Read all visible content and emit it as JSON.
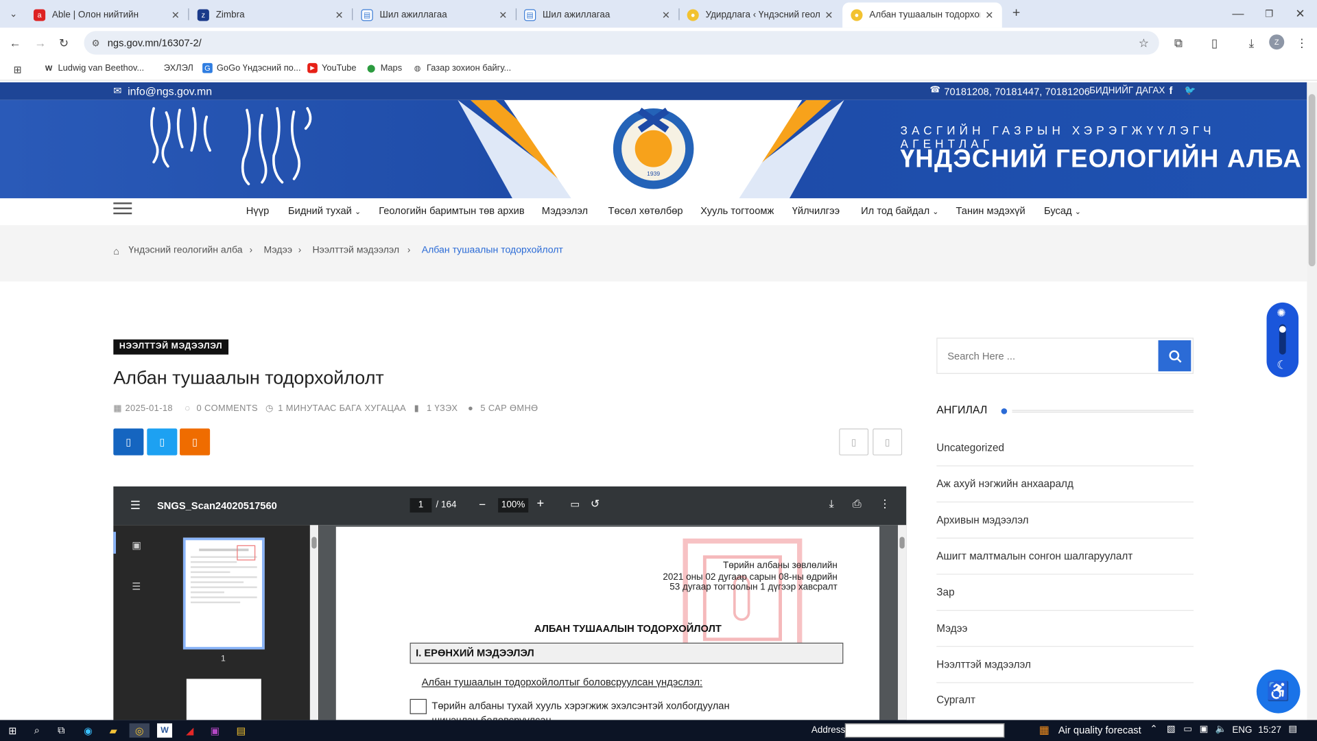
{
  "browser": {
    "tabs": [
      {
        "title": "Able | Олон нийтийн",
        "active": false
      },
      {
        "title": "Zimbra",
        "active": false
      },
      {
        "title": "Шил ажиллагаа",
        "active": false
      },
      {
        "title": "Шил ажиллагаа",
        "active": false
      },
      {
        "title": "Удирдлага ‹ Үндэсний геологи",
        "active": false
      },
      {
        "title": "Албан тушаалын тодорхойлол",
        "active": true
      }
    ],
    "url": "ngs.gov.mn/16307-2/",
    "bookmarks": [
      "Ludwig van Beethov...",
      "ЭХЛЭЛ",
      "GoGo Үндэсний по...",
      "YouTube",
      "Maps",
      "Газар зохион байгу..."
    ],
    "avatar_letter": "Z"
  },
  "site": {
    "email": "info@ngs.gov.mn",
    "phones": "70181208, 70181447, 70181206",
    "contact_label": "БИДНИЙГ ДАГАХ",
    "agency_line": "ЗАСГИЙН ГАЗРЫН ХЭРЭГЖҮҮЛЭГЧ АГЕНТЛАГ",
    "org_name": "ҮНДЭСНИЙ ГЕОЛОГИЙН АЛБА",
    "nav": [
      "Нүүр",
      "Бидний тухай",
      "Геологийн баримтын төв архив",
      "Мэдээлэл",
      "Төсөл хөтөлбөр",
      "Хууль тогтоомж",
      "Үйлчилгээ",
      "Ил тод байдал",
      "Танин мэдэхүй",
      "Бусад"
    ],
    "breadcrumb": [
      "Үндэсний геологийн алба",
      "Мэдээ",
      "Нээлттэй мэдээлэл",
      "Албан тушаалын тодорхойлолт"
    ]
  },
  "post": {
    "category": "НЭЭЛТТЭЙ МЭДЭЭЛЭЛ",
    "title": "Албан тушаалын тодорхойлолт",
    "date": "2025-01-18",
    "comments": "0 COMMENTS",
    "read_time": "1 МИНУТААС БАГА ХУГАЦАА",
    "views": "1 ҮЗЭХ",
    "ago": "5 САР ӨМНӨ"
  },
  "pdf": {
    "filename": "SNGS_Scan24020517560",
    "current_page": "1",
    "total_pages": "/ 164",
    "zoom": "100%",
    "thumb_label": "1",
    "doc": {
      "header_line1": "Төрийн албаны зөвлөлийн",
      "header_line2": "2021 оны 02 дугаар сарын 08-ны өдрийн",
      "header_line3": "53  дугаар тогтоолын 1 дүгээр хавсралт",
      "title": "АЛБАН ТУШААЛЫН ТОДОРХОЙЛОЛТ",
      "section1": "I. ЕРӨНХИЙ МЭДЭЭЛЭЛ",
      "basis": "Албан тушаалын тодорхойлолтыг боловсруулсан үндэслэл:",
      "option1": "Төрийн албаны тухай хууль хэрэгжиж эхэлсэнтэй холбогдуулан",
      "option1_cont": "шинэчлэн боловсруулсан"
    }
  },
  "sidebar": {
    "search_placeholder": "Search Here ...",
    "categories_title": "АНГИЛАЛ",
    "categories": [
      "Uncategorized",
      "Аж ахуй нэгжийн анхааралд",
      "Архивын мэдээлэл",
      "Ашигт малтмалын сонгон шалгаруулалт",
      "Зар",
      "Мэдээ",
      "Нээлттэй мэдээлэл",
      "Сургалт"
    ]
  },
  "taskbar": {
    "address_label": "Address",
    "weather": "Air quality forecast",
    "lang": "ENG",
    "time": "15:27"
  },
  "colors": {
    "brand_blue": "#1e4596",
    "accent_orange": "#f7a21b",
    "search_button": "#2b6bd6"
  }
}
